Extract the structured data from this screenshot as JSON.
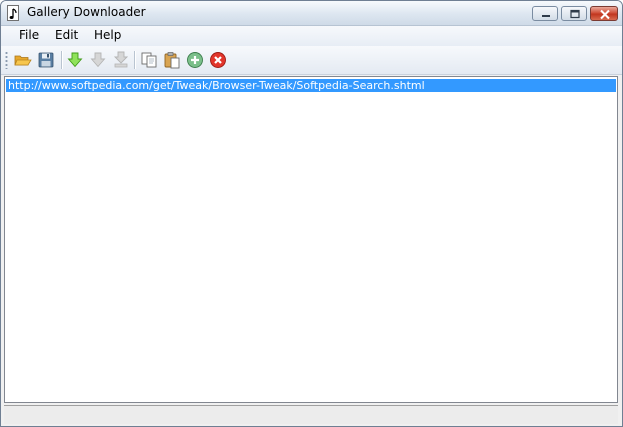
{
  "window": {
    "title": "Gallery Downloader",
    "app_icon": "music-note-icon",
    "caption_buttons": [
      "minimize-icon",
      "maximize-icon",
      "close-icon"
    ]
  },
  "menubar": {
    "items": [
      {
        "label": "File"
      },
      {
        "label": "Edit"
      },
      {
        "label": "Help"
      }
    ]
  },
  "toolbar": {
    "buttons": [
      {
        "icon": "open-folder-icon",
        "enabled": true
      },
      {
        "icon": "save-disk-icon",
        "enabled": true
      },
      {
        "icon": "download-arrow-icon",
        "enabled": true
      },
      {
        "icon": "download-arrow-disabled-icon",
        "enabled": false
      },
      {
        "icon": "download-all-disabled-icon",
        "enabled": false
      },
      {
        "icon": "copy-icon",
        "enabled": true
      },
      {
        "icon": "paste-icon",
        "enabled": true
      },
      {
        "icon": "add-globe-icon",
        "enabled": true
      },
      {
        "icon": "stop-icon",
        "enabled": true
      }
    ]
  },
  "url_list": {
    "items": [
      {
        "url": "http://www.softpedia.com/get/Tweak/Browser-Tweak/Softpedia-Search.shtml",
        "selected": true
      }
    ]
  },
  "colors": {
    "selection": "#3399ff",
    "selection_text": "#ffffff",
    "close_button": "#c1361f"
  },
  "statusbar": {
    "text": ""
  }
}
